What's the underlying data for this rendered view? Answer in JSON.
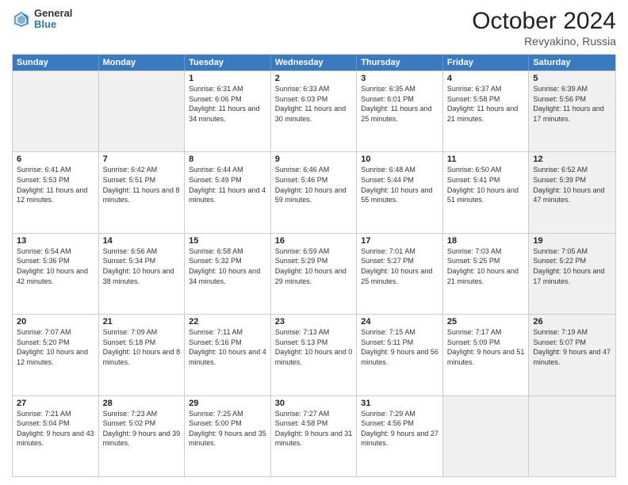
{
  "header": {
    "logo_general": "General",
    "logo_blue": "Blue",
    "title": "October 2024",
    "location": "Revyakino, Russia"
  },
  "days_of_week": [
    "Sunday",
    "Monday",
    "Tuesday",
    "Wednesday",
    "Thursday",
    "Friday",
    "Saturday"
  ],
  "weeks": [
    [
      {
        "day": "",
        "sunrise": "",
        "sunset": "",
        "daylight": "",
        "shaded": true
      },
      {
        "day": "",
        "sunrise": "",
        "sunset": "",
        "daylight": "",
        "shaded": true
      },
      {
        "day": "1",
        "sunrise": "Sunrise: 6:31 AM",
        "sunset": "Sunset: 6:06 PM",
        "daylight": "Daylight: 11 hours and 34 minutes."
      },
      {
        "day": "2",
        "sunrise": "Sunrise: 6:33 AM",
        "sunset": "Sunset: 6:03 PM",
        "daylight": "Daylight: 11 hours and 30 minutes."
      },
      {
        "day": "3",
        "sunrise": "Sunrise: 6:35 AM",
        "sunset": "Sunset: 6:01 PM",
        "daylight": "Daylight: 11 hours and 25 minutes."
      },
      {
        "day": "4",
        "sunrise": "Sunrise: 6:37 AM",
        "sunset": "Sunset: 5:58 PM",
        "daylight": "Daylight: 11 hours and 21 minutes."
      },
      {
        "day": "5",
        "sunrise": "Sunrise: 6:39 AM",
        "sunset": "Sunset: 5:56 PM",
        "daylight": "Daylight: 11 hours and 17 minutes.",
        "shaded": true
      }
    ],
    [
      {
        "day": "6",
        "sunrise": "Sunrise: 6:41 AM",
        "sunset": "Sunset: 5:53 PM",
        "daylight": "Daylight: 11 hours and 12 minutes."
      },
      {
        "day": "7",
        "sunrise": "Sunrise: 6:42 AM",
        "sunset": "Sunset: 5:51 PM",
        "daylight": "Daylight: 11 hours and 8 minutes."
      },
      {
        "day": "8",
        "sunrise": "Sunrise: 6:44 AM",
        "sunset": "Sunset: 5:49 PM",
        "daylight": "Daylight: 11 hours and 4 minutes."
      },
      {
        "day": "9",
        "sunrise": "Sunrise: 6:46 AM",
        "sunset": "Sunset: 5:46 PM",
        "daylight": "Daylight: 10 hours and 59 minutes."
      },
      {
        "day": "10",
        "sunrise": "Sunrise: 6:48 AM",
        "sunset": "Sunset: 5:44 PM",
        "daylight": "Daylight: 10 hours and 55 minutes."
      },
      {
        "day": "11",
        "sunrise": "Sunrise: 6:50 AM",
        "sunset": "Sunset: 5:41 PM",
        "daylight": "Daylight: 10 hours and 51 minutes."
      },
      {
        "day": "12",
        "sunrise": "Sunrise: 6:52 AM",
        "sunset": "Sunset: 5:39 PM",
        "daylight": "Daylight: 10 hours and 47 minutes.",
        "shaded": true
      }
    ],
    [
      {
        "day": "13",
        "sunrise": "Sunrise: 6:54 AM",
        "sunset": "Sunset: 5:36 PM",
        "daylight": "Daylight: 10 hours and 42 minutes."
      },
      {
        "day": "14",
        "sunrise": "Sunrise: 6:56 AM",
        "sunset": "Sunset: 5:34 PM",
        "daylight": "Daylight: 10 hours and 38 minutes."
      },
      {
        "day": "15",
        "sunrise": "Sunrise: 6:58 AM",
        "sunset": "Sunset: 5:32 PM",
        "daylight": "Daylight: 10 hours and 34 minutes."
      },
      {
        "day": "16",
        "sunrise": "Sunrise: 6:59 AM",
        "sunset": "Sunset: 5:29 PM",
        "daylight": "Daylight: 10 hours and 29 minutes."
      },
      {
        "day": "17",
        "sunrise": "Sunrise: 7:01 AM",
        "sunset": "Sunset: 5:27 PM",
        "daylight": "Daylight: 10 hours and 25 minutes."
      },
      {
        "day": "18",
        "sunrise": "Sunrise: 7:03 AM",
        "sunset": "Sunset: 5:25 PM",
        "daylight": "Daylight: 10 hours and 21 minutes."
      },
      {
        "day": "19",
        "sunrise": "Sunrise: 7:05 AM",
        "sunset": "Sunset: 5:22 PM",
        "daylight": "Daylight: 10 hours and 17 minutes.",
        "shaded": true
      }
    ],
    [
      {
        "day": "20",
        "sunrise": "Sunrise: 7:07 AM",
        "sunset": "Sunset: 5:20 PM",
        "daylight": "Daylight: 10 hours and 12 minutes."
      },
      {
        "day": "21",
        "sunrise": "Sunrise: 7:09 AM",
        "sunset": "Sunset: 5:18 PM",
        "daylight": "Daylight: 10 hours and 8 minutes."
      },
      {
        "day": "22",
        "sunrise": "Sunrise: 7:11 AM",
        "sunset": "Sunset: 5:16 PM",
        "daylight": "Daylight: 10 hours and 4 minutes."
      },
      {
        "day": "23",
        "sunrise": "Sunrise: 7:13 AM",
        "sunset": "Sunset: 5:13 PM",
        "daylight": "Daylight: 10 hours and 0 minutes."
      },
      {
        "day": "24",
        "sunrise": "Sunrise: 7:15 AM",
        "sunset": "Sunset: 5:11 PM",
        "daylight": "Daylight: 9 hours and 56 minutes."
      },
      {
        "day": "25",
        "sunrise": "Sunrise: 7:17 AM",
        "sunset": "Sunset: 5:09 PM",
        "daylight": "Daylight: 9 hours and 51 minutes."
      },
      {
        "day": "26",
        "sunrise": "Sunrise: 7:19 AM",
        "sunset": "Sunset: 5:07 PM",
        "daylight": "Daylight: 9 hours and 47 minutes.",
        "shaded": true
      }
    ],
    [
      {
        "day": "27",
        "sunrise": "Sunrise: 7:21 AM",
        "sunset": "Sunset: 5:04 PM",
        "daylight": "Daylight: 9 hours and 43 minutes."
      },
      {
        "day": "28",
        "sunrise": "Sunrise: 7:23 AM",
        "sunset": "Sunset: 5:02 PM",
        "daylight": "Daylight: 9 hours and 39 minutes."
      },
      {
        "day": "29",
        "sunrise": "Sunrise: 7:25 AM",
        "sunset": "Sunset: 5:00 PM",
        "daylight": "Daylight: 9 hours and 35 minutes."
      },
      {
        "day": "30",
        "sunrise": "Sunrise: 7:27 AM",
        "sunset": "Sunset: 4:58 PM",
        "daylight": "Daylight: 9 hours and 31 minutes."
      },
      {
        "day": "31",
        "sunrise": "Sunrise: 7:29 AM",
        "sunset": "Sunset: 4:56 PM",
        "daylight": "Daylight: 9 hours and 27 minutes."
      },
      {
        "day": "",
        "sunrise": "",
        "sunset": "",
        "daylight": "",
        "shaded": true
      },
      {
        "day": "",
        "sunrise": "",
        "sunset": "",
        "daylight": "",
        "shaded": true
      }
    ]
  ]
}
